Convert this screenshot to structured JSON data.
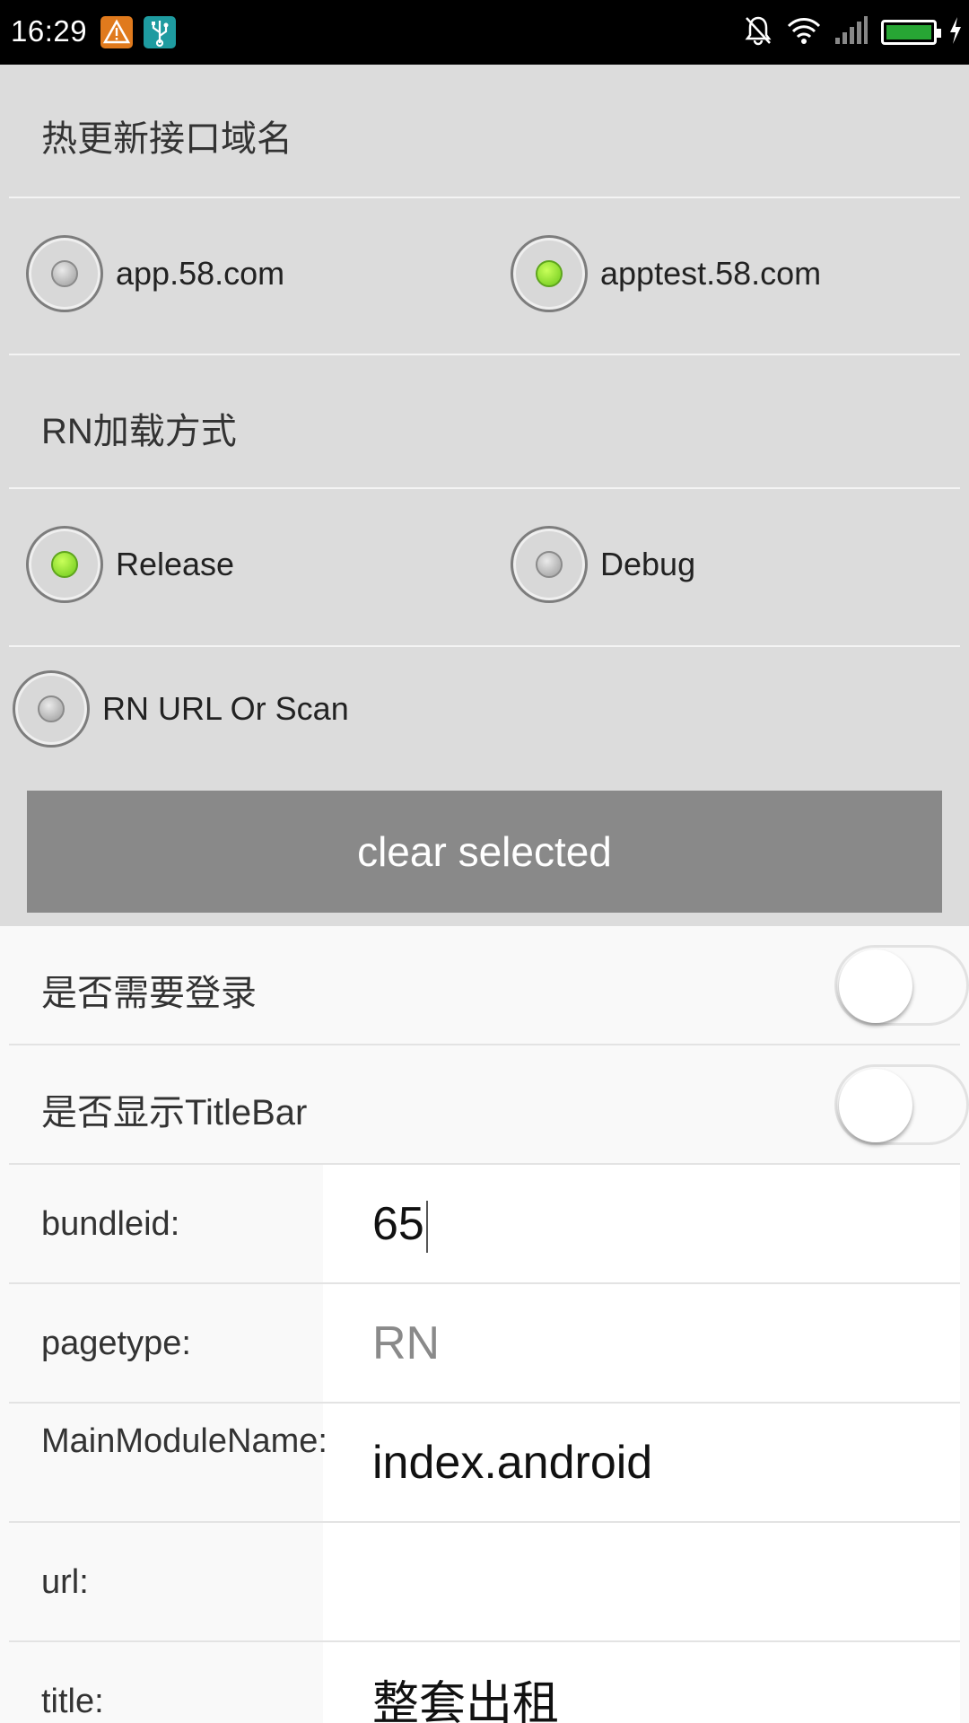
{
  "status_bar": {
    "time": "16:29",
    "icons": [
      "warning-icon",
      "usb-icon",
      "mute-icon",
      "wifi-icon",
      "signal-icon",
      "battery-icon"
    ]
  },
  "hotupdate": {
    "title": "热更新接口域名",
    "options": [
      {
        "label": "app.58.com",
        "checked": false
      },
      {
        "label": "apptest.58.com",
        "checked": true
      }
    ]
  },
  "rn_load": {
    "title": "RN加载方式",
    "options": [
      {
        "label": "Release",
        "checked": true
      },
      {
        "label": "Debug",
        "checked": false
      },
      {
        "label": "RN URL Or Scan",
        "checked": false
      }
    ]
  },
  "clear_button": "clear selected",
  "toggles": [
    {
      "label": "是否需要登录",
      "on": false
    },
    {
      "label": "是否显示TitleBar",
      "on": false
    }
  ],
  "fields": [
    {
      "label": "bundleid:",
      "value": "65",
      "placeholder": ""
    },
    {
      "label": "pagetype:",
      "value": "",
      "placeholder": "RN"
    },
    {
      "label": "MainModuleName:",
      "value": "index.android",
      "placeholder": ""
    },
    {
      "label": "url:",
      "value": "",
      "placeholder": ""
    },
    {
      "label": "title:",
      "value": "整套出租",
      "placeholder": ""
    }
  ],
  "colors": {
    "checked_radio": "#7fd62a",
    "clear_button_bg": "#898989",
    "battery": "#27a534"
  }
}
